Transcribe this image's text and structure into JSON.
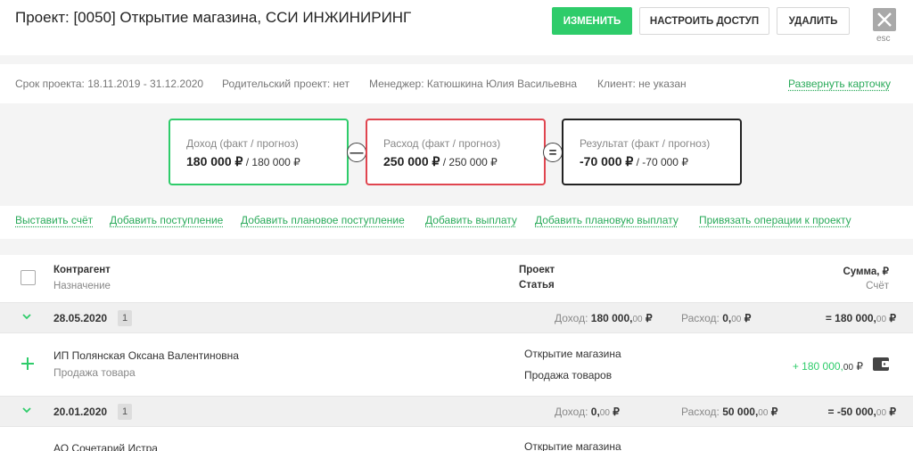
{
  "header": {
    "title": "Проект: [0050] Открытие магазина, ССИ ИНЖИНИРИНГ",
    "edit_button": "ИЗМЕНИТЬ",
    "access_button": "НАСТРОИТЬ ДОСТУП",
    "delete_button": "УДАЛИТЬ",
    "esc_label": "esc"
  },
  "info": {
    "period": "Срок проекта: 18.11.2019 - 31.12.2020",
    "parent": "Родительский проект: нет",
    "manager": "Менеджер: Катюшкина Юлия Васильевна",
    "client": "Клиент: не указан",
    "expand_link": "Развернуть карточку"
  },
  "cards": {
    "income": {
      "label": "Доход (факт / прогноз)",
      "fact": "180 000  ₽",
      "forecast": " / 180 000  ₽"
    },
    "minus": "—",
    "expense": {
      "label": "Расход (факт / прогноз)",
      "fact": "250 000  ₽",
      "forecast": " / 250 000  ₽"
    },
    "equals": "=",
    "result": {
      "label": "Результат (факт / прогноз)",
      "fact": "-70 000  ₽",
      "forecast": " / -70 000  ₽"
    }
  },
  "actions": [
    "Выставить счёт",
    "Добавить поступление",
    "Добавить плановое поступление",
    "Добавить выплату",
    "Добавить плановую выплату",
    "Привязать операции к проекту"
  ],
  "table": {
    "col_counterparty": "Контрагент",
    "col_purpose": "Назначение",
    "col_project": "Проект",
    "col_article": "Статья",
    "col_sum": "Сумма, ₽",
    "col_account": "Счёт",
    "groups": [
      {
        "date": "28.05.2020",
        "count": "1",
        "income_label": "Доход:",
        "income": "180 000,",
        "income_cents": "00",
        "expense_label": "Расход:",
        "expense": "0,",
        "expense_cents": "00",
        "total": "= 180 000,",
        "total_cents": "00",
        "currency": "₽"
      },
      {
        "date": "20.01.2020",
        "count": "1",
        "income_label": "Доход:",
        "income": "0,",
        "income_cents": "00",
        "expense_label": "Расход:",
        "expense": "50 000,",
        "expense_cents": "00",
        "total": "= -50 000,",
        "total_cents": "00",
        "currency": "₽"
      }
    ],
    "rows": [
      {
        "counterparty": "ИП Полянская Оксана Валентиновна",
        "purpose": "Продажа товара",
        "project": "Открытие магазина",
        "article": "Продажа товаров",
        "amount": "+ 180 000,",
        "amount_cents": "00",
        "currency": "₽"
      },
      {
        "counterparty": "АО Сочетарий Истра",
        "project": "Открытие магазина"
      }
    ]
  },
  "colors": {
    "accent": "#2ecc6a",
    "expense": "#e0454f",
    "result": "#222222"
  }
}
